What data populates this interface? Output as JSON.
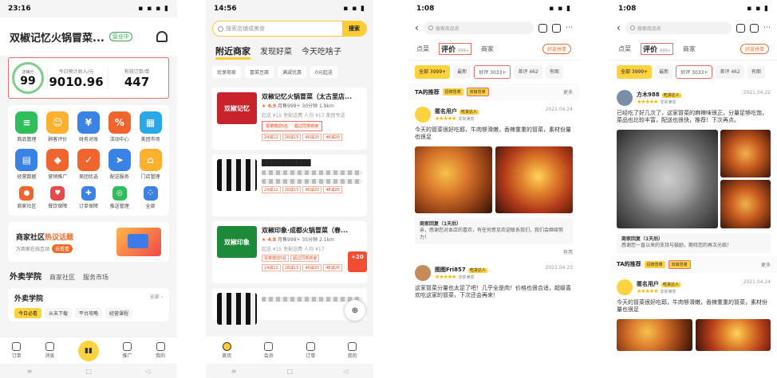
{
  "p1": {
    "time": "23:16",
    "status_icons": "▪ ▪ ▪ ▮",
    "store": "双椒记忆火锅冒菜...",
    "store_status": "营业中",
    "score_label": "店铺分",
    "score": "99",
    "income_label": "今日预计收入/元",
    "income": "9010.96",
    "orders_label": "有效订单/单",
    "orders": "447",
    "grid": [
      {
        "label": "商品管理",
        "icon": "≡",
        "color": "#2fbf5a"
      },
      {
        "label": "顾客评价",
        "icon": "☺",
        "color": "#ffb02e"
      },
      {
        "label": "财务对账",
        "icon": "¥",
        "color": "#3b82e6"
      },
      {
        "label": "活动中心",
        "icon": "%",
        "color": "#f0652e"
      },
      {
        "label": "美团市场",
        "icon": "▦",
        "color": "#29a8e8"
      },
      {
        "label": "经营数据",
        "icon": "▤",
        "color": "#3b82e6"
      },
      {
        "label": "营销推广",
        "icon": "◆",
        "color": "#f0652e"
      },
      {
        "label": "美团优选",
        "icon": "✓",
        "color": "#f0652e"
      },
      {
        "label": "配送服务",
        "icon": "➤",
        "color": "#3b82e6"
      },
      {
        "label": "门店管理",
        "icon": "⌂",
        "color": "#ffb02e"
      },
      {
        "label": "商家社区",
        "icon": "●",
        "color": "#f0652e"
      },
      {
        "label": "餐饮保障",
        "icon": "♥",
        "color": "#e64a4a"
      },
      {
        "label": "订单保障",
        "icon": "✚",
        "color": "#3b82e6"
      },
      {
        "label": "推送管理",
        "icon": "◎",
        "color": "#2fbf5a"
      },
      {
        "label": "全部",
        "icon": "⁘",
        "color": "#3b82e6"
      }
    ],
    "community_title_a": "商家社区",
    "community_title_b": "热议话题",
    "community_sub": "万商家在线互动",
    "community_go": "去看看",
    "tabs": [
      "外卖学院",
      "商家社区",
      "服务市场"
    ],
    "school_title": "外卖学院",
    "school_more": "全部 ›",
    "school_chips": [
      "今日必看",
      "从未下载",
      "平台攻略",
      "经营课程"
    ],
    "nav": [
      "订单",
      "消息",
      "",
      "推广",
      "我的"
    ],
    "nav_center": "▮▮",
    "sys": [
      "≡",
      "□",
      "◁"
    ]
  },
  "p2": {
    "time": "14:56",
    "status_icons": "▪ ▪ ▮",
    "search_placeholder": "搜索店铺或美食",
    "search_btn": "搜索",
    "tabs": [
      "附近商家",
      "发现好菜",
      "今天吃啥子"
    ],
    "chips": [
      "优享商家",
      "冒菜豆腐",
      "满减优惠",
      "0元起送"
    ],
    "shop1": {
      "thumb": "双椒记忆",
      "name": "双椒记忆火锅冒菜（太古里店...",
      "rating": "4.9",
      "meta1": "月售999+  30分钟 1.9km",
      "meta2": "起送 ¥15 免配送费 人均 ¥17",
      "brand": "美团专送",
      "tag1": "冒菜榜前5名",
      "tag2": "超过同类商家",
      "promo": [
        "24减12",
        "28减15",
        "40减20",
        "48减26"
      ]
    },
    "shop2": {
      "name": "██████████",
      "promo": [
        "24减12",
        "28减15",
        "40减20",
        "48减26"
      ]
    },
    "shop3": {
      "thumb": "双椒印象",
      "name": "双椒印象·成都火锅冒菜（春...",
      "rating": "4.8",
      "meta1": "月售999+  35分钟 2.1km",
      "meta2": "起送 ¥15 免配送费 人均 ¥17",
      "tag1": "冒菜榜前5名",
      "tag2": "超过同类商家",
      "promo": [
        "24减12",
        "28减15",
        "40减20",
        "48减26"
      ],
      "coupon": "+20"
    },
    "cart": "⊕",
    "nav": [
      "首页",
      "会员",
      "订单",
      "我的"
    ]
  },
  "p3": {
    "time": "1:08",
    "status_icons": "▪ ▪ ▮",
    "search_placeholder": "搜索商品名",
    "tabs": [
      "点菜",
      "评价",
      "商家"
    ],
    "review_count": "999+",
    "fav_btn": "好友拼单",
    "chips": [
      "全部 3999+",
      "最新",
      "好评 3033+",
      "差评 462",
      "有图"
    ],
    "ta_label": "TA的推荐",
    "ta_tags": [
      "招牌冒菜",
      "双椒冒菜"
    ],
    "ta_more": "更多",
    "r1_user": "匿名用户",
    "r1_level": "吃货达人",
    "r1_stars": "★★★★★",
    "r1_score": "非常满意",
    "r1_date": "2021.04.24",
    "r1_text": "今天的冒菜很好吃耶，牛肉够滑嫩，香辣重重的冒菜，素材份量也很足",
    "biz_head": "商家回复（1天后）",
    "biz_text": "亲，感谢您对本店的喜欢，有任何意见欢迎联系我们，我们会继续努力！",
    "like": "有用",
    "r2_user": "图图Fri857",
    "r2_level": "吃货达人",
    "r2_stars": "★★★★★",
    "r2_score": "非常满意",
    "r2_date": "2021.04.23",
    "r2_text": "这家冒菜分量也太足了吧！几乎全是肉！价格也很合适，超级喜欢吃这家的冒菜，下次还会再来！"
  },
  "p4": {
    "time": "1:08",
    "status_icons": "▪ ▪ ▮",
    "search_placeholder": "搜索商品名",
    "tabs": [
      "点菜",
      "评价",
      "商家"
    ],
    "review_count": "999+",
    "fav_btn": "好友拼单",
    "chips": [
      "全部 3999+",
      "最新",
      "好评 3033+",
      "差评 462",
      "有图"
    ],
    "r1_user": "方木988",
    "r1_level": "吃货达人",
    "r1_stars": "★★★★★",
    "r1_score": "非常满意",
    "r1_date": "2021.04.22",
    "r1_text": "已经吃了好几次了，这家冒菜的麻辣味很正，分量足够吃饱，菜品也比较丰富，配送也很快，推荐！下次再点。",
    "biz_head": "商家回复（1天后）",
    "biz_text": "感谢您一直以来的支持与鼓励，期待您的再次光临！",
    "ta_label": "TA的推荐",
    "ta_tags": [
      "招牌冒菜",
      "双椒冒菜"
    ],
    "ta_more": "更多",
    "r2_user": "匿名用户",
    "r2_level": "吃货达人",
    "r2_stars": "★★★★★",
    "r2_score": "非常满意",
    "r2_date": "2021.04.24",
    "r2_text": "今天的冒菜很好吃耶，牛肉够滑嫩，香辣重重的冒菜，素材份量也很足"
  }
}
